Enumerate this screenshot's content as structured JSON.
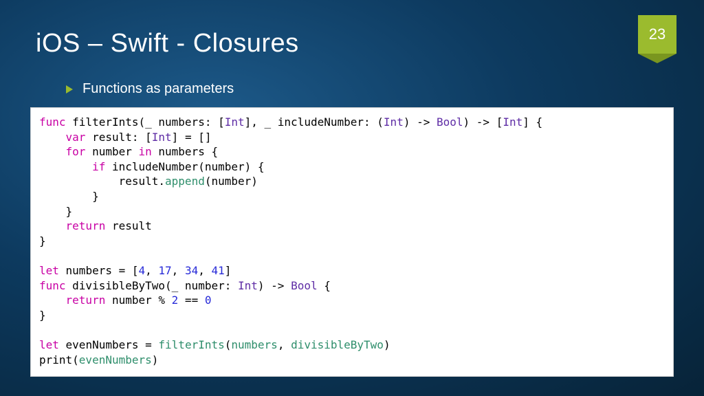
{
  "slide": {
    "page_number": "23",
    "title": "iOS – Swift - Closures",
    "bullet": "Functions as parameters"
  },
  "code": {
    "kw_func": "func",
    "kw_var": "var",
    "kw_for": "for",
    "kw_in": "in",
    "kw_if": "if",
    "kw_return": "return",
    "kw_let": "let",
    "t_int": "Int",
    "t_bool": "Bool",
    "fn_append": "append",
    "id_numbers": "numbers",
    "id_divisibleByTwo": "divisibleByTwo",
    "id_evenNumbers": "evenNumbers",
    "id_filterInts": "filterInts",
    "l1a": " filterInts(_ numbers: [",
    "l1b": "], _ includeNumber: (",
    "l1c": ") -> ",
    "l1d": ") -> [",
    "l1e": "] {",
    "l2a": " result: [",
    "l2b": "] = []",
    "l3a": " number ",
    "l3b": " numbers {",
    "l4a": " includeNumber(number) {",
    "l5a": "            result.",
    "l5b": "(number)",
    "l6": "        }",
    "l7": "    }",
    "l8": " result",
    "l9": "}",
    "l11a": " numbers = [",
    "n4": "4",
    "comma": ", ",
    "n17": "17",
    "n34": "34",
    "n41": "41",
    "l11b": "]",
    "l12a": " divisibleByTwo(_ number: ",
    "l12b": ") -> ",
    "l12c": " {",
    "l13a": " number % ",
    "n2": "2",
    "l13b": " == ",
    "n0": "0",
    "l16a": " evenNumbers = ",
    "l16open": "(",
    "l16close": ")",
    "l17a": "print(",
    "l17b": ")",
    "ind4": "    ",
    "ind8": "        "
  }
}
